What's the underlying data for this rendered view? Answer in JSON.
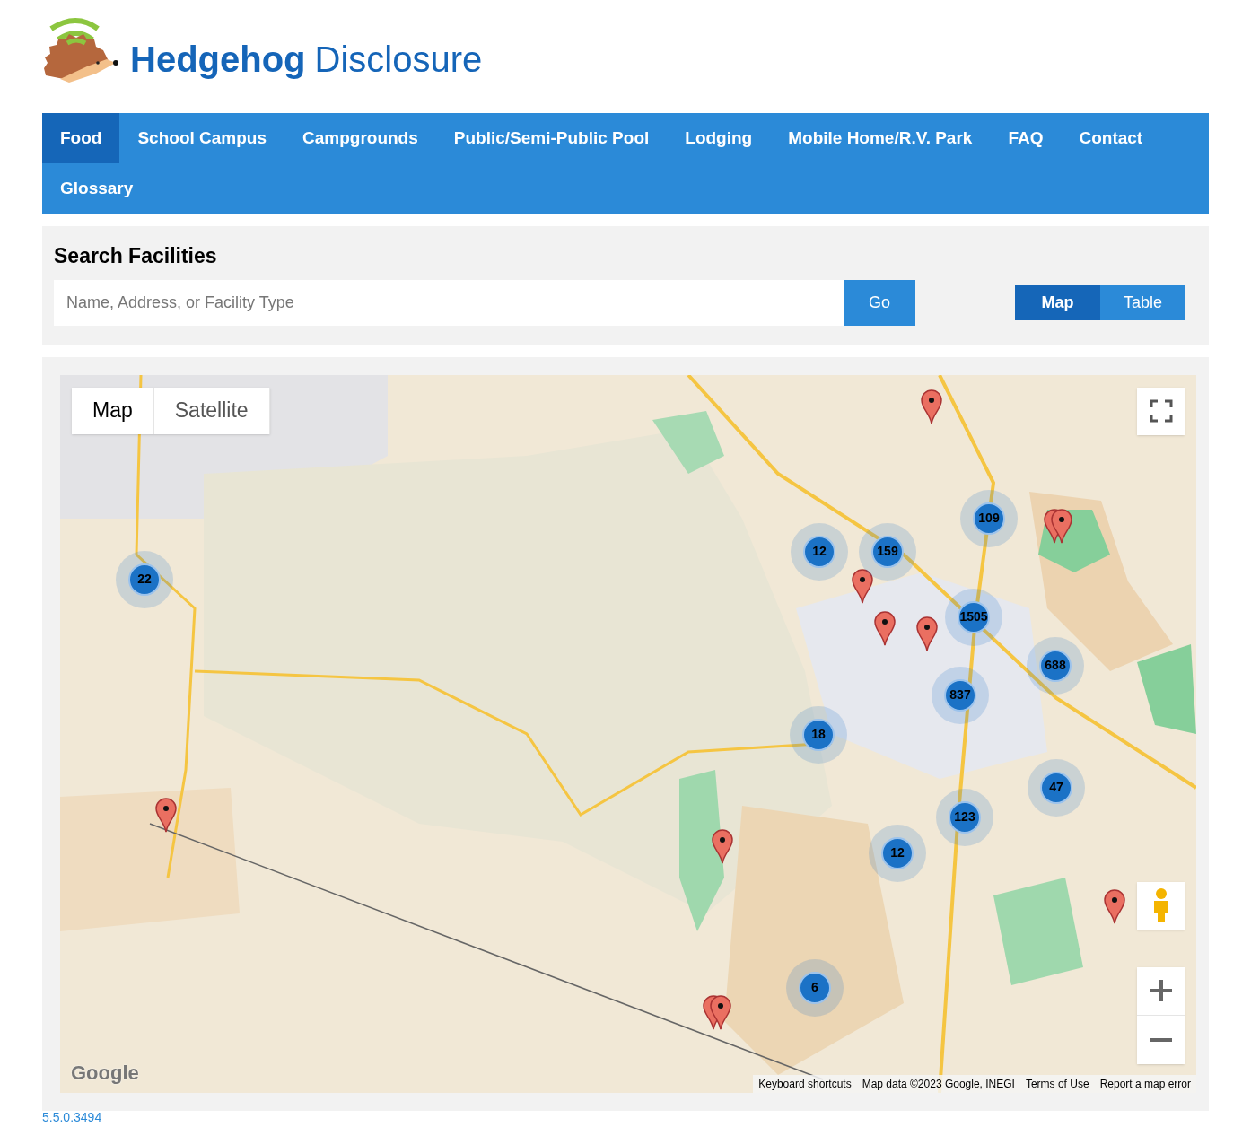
{
  "brand": {
    "bold": "Hedgehog",
    "light": "Disclosure"
  },
  "nav": [
    {
      "label": "Food",
      "selected": true
    },
    {
      "label": "School Campus",
      "selected": false
    },
    {
      "label": "Campgrounds",
      "selected": false
    },
    {
      "label": "Public/Semi-Public Pool",
      "selected": false
    },
    {
      "label": "Lodging",
      "selected": false
    },
    {
      "label": "Mobile Home/R.V. Park",
      "selected": false
    },
    {
      "label": "FAQ",
      "selected": false
    },
    {
      "label": "Contact",
      "selected": false
    },
    {
      "label": "Glossary",
      "selected": false
    }
  ],
  "search": {
    "title": "Search Facilities",
    "placeholder": "Name, Address, or Facility Type",
    "button": "Go"
  },
  "view_toggle": [
    {
      "label": "Map",
      "selected": true
    },
    {
      "label": "Table",
      "selected": false
    }
  ],
  "map": {
    "type_toggle": [
      {
        "label": "Map",
        "selected": true
      },
      {
        "label": "Satellite",
        "selected": false
      }
    ],
    "clusters": [
      "22",
      "109",
      "12",
      "159",
      "1505",
      "688",
      "837",
      "18",
      "47",
      "123",
      "12",
      "6"
    ],
    "logo": "Google",
    "attribution": [
      "Keyboard shortcuts",
      "Map data ©2023 Google, INEGI",
      "Terms of Use",
      "Report a map error"
    ]
  },
  "version": "5.5.0.3494"
}
